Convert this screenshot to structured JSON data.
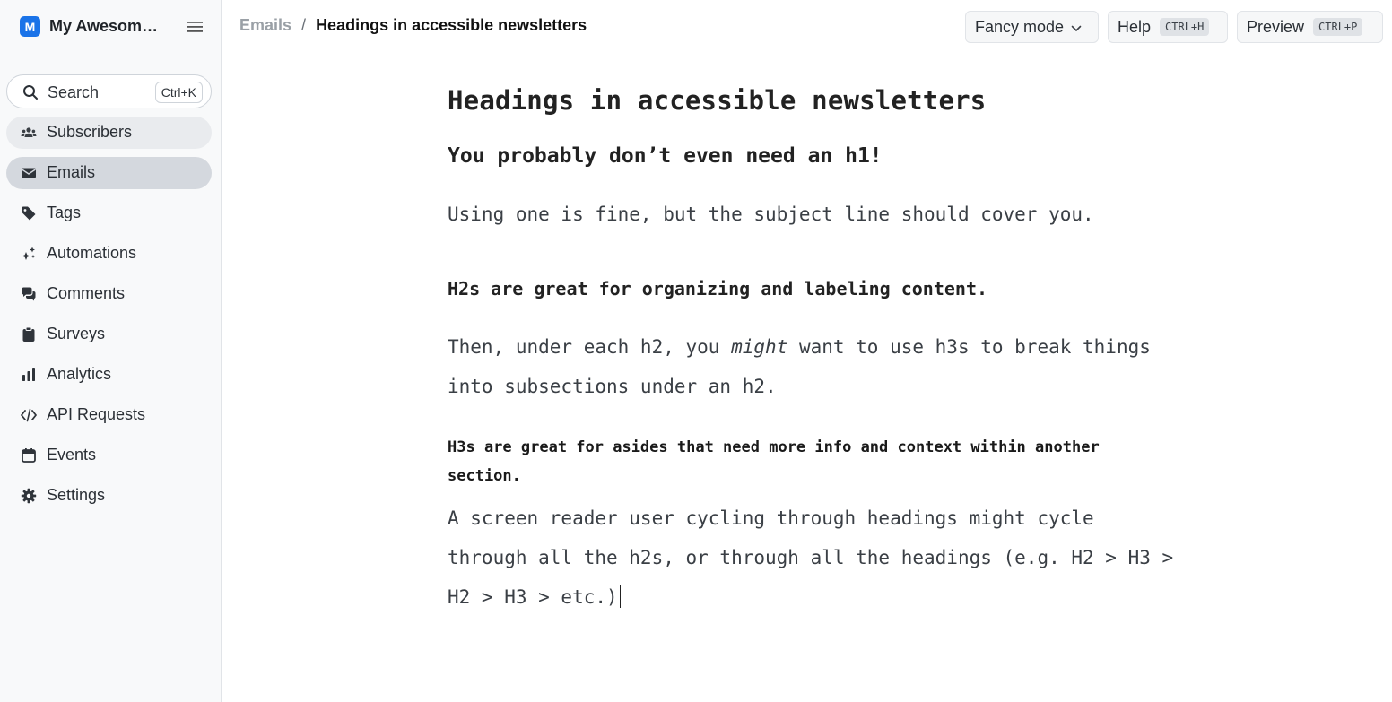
{
  "app": {
    "logo_letter": "M",
    "name": "My Awesom…"
  },
  "sidebar": {
    "search": {
      "label": "Search",
      "shortcut": "Ctrl+K"
    },
    "items": [
      {
        "label": "Subscribers",
        "icon": "users-icon",
        "state": "hover"
      },
      {
        "label": "Emails",
        "icon": "envelope-icon",
        "state": "active"
      },
      {
        "label": "Tags",
        "icon": "tag-icon",
        "state": ""
      },
      {
        "label": "Automations",
        "icon": "sparkles-icon",
        "state": ""
      },
      {
        "label": "Comments",
        "icon": "comments-icon",
        "state": ""
      },
      {
        "label": "Surveys",
        "icon": "clipboard-icon",
        "state": ""
      },
      {
        "label": "Analytics",
        "icon": "bar-chart-icon",
        "state": ""
      },
      {
        "label": "API Requests",
        "icon": "code-icon",
        "state": ""
      },
      {
        "label": "Events",
        "icon": "calendar-icon",
        "state": ""
      },
      {
        "label": "Settings",
        "icon": "gear-icon",
        "state": ""
      }
    ]
  },
  "header": {
    "breadcrumb_parent": "Emails",
    "breadcrumb_separator": "/",
    "breadcrumb_current": "Headings in accessible newsletters",
    "fancy_mode_label": "Fancy mode",
    "help_label": "Help",
    "help_shortcut": "CTRL+H",
    "preview_label": "Preview",
    "preview_shortcut": "CTRL+P"
  },
  "document": {
    "title": "Headings in accessible newsletters",
    "heading_1": "You probably don’t even need an h1!",
    "paragraph_1": "Using one is fine, but the subject line should cover you.",
    "heading_2": "H2s are great for organizing and labeling content.",
    "paragraph_2_before": "Then, under each h2, you ",
    "paragraph_2_emphasis": "might",
    "paragraph_2_after": " want to use h3s to break things into subsections under an h2.",
    "heading_3": "H3s are great for asides that need more info and context within another section.",
    "paragraph_3": "A screen reader user cycling through headings might cycle through all the h2s, or through all the headings (e.g. H2 > H3 > H2 > H3 > etc.)"
  },
  "colors": {
    "brand": "#1a73e8",
    "active_nav": "#d4d8de",
    "hover_nav": "#e9ebee"
  }
}
